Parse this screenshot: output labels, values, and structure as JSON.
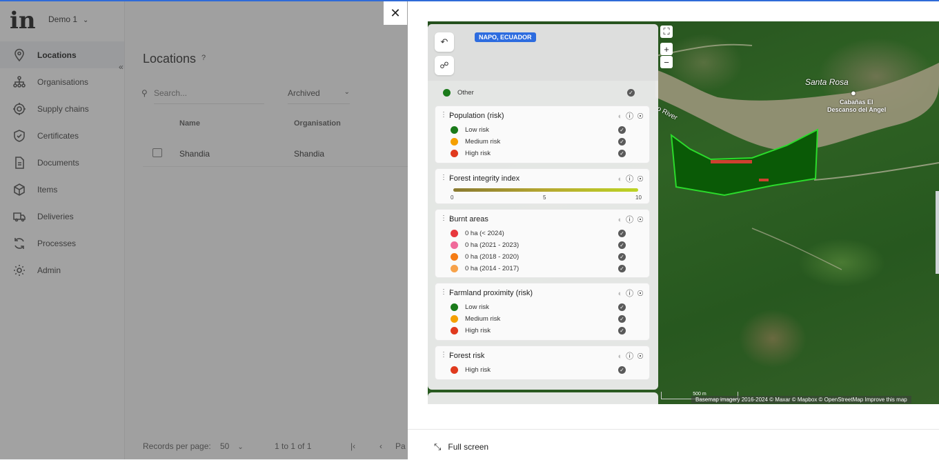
{
  "app": {
    "logo": "in",
    "org_selector": "Demo 1"
  },
  "sidebar": {
    "items": [
      {
        "label": "Locations",
        "icon": "location-pin-icon",
        "active": true
      },
      {
        "label": "Organisations",
        "icon": "org-chart-icon"
      },
      {
        "label": "Supply chains",
        "icon": "target-icon"
      },
      {
        "label": "Certificates",
        "icon": "shield-check-icon"
      },
      {
        "label": "Documents",
        "icon": "document-icon"
      },
      {
        "label": "Items",
        "icon": "cube-icon"
      },
      {
        "label": "Deliveries",
        "icon": "truck-icon"
      },
      {
        "label": "Processes",
        "icon": "refresh-icon"
      },
      {
        "label": "Admin",
        "icon": "gear-icon"
      }
    ]
  },
  "main": {
    "title": "Locations",
    "help": "?",
    "search_placeholder": "Search...",
    "filter": "Archived",
    "columns": [
      "Name",
      "Organisation"
    ],
    "rows": [
      {
        "name": "Shandia",
        "organisation": "Shandia"
      }
    ],
    "footer": {
      "records_label": "Records per page:",
      "records_value": "50",
      "range": "1 to 1 of 1",
      "page_prefix": "Pa"
    }
  },
  "modal": {
    "location_badge": "NAPO, ECUADOR",
    "partial_item": "Other",
    "layers": [
      {
        "title": "Population (risk)",
        "items": [
          {
            "label": "Low risk",
            "color": "#1a7a1a"
          },
          {
            "label": "Medium risk",
            "color": "#f5a000"
          },
          {
            "label": "High risk",
            "color": "#e03a1e"
          }
        ]
      },
      {
        "title": "Forest integrity index",
        "scale": [
          "0",
          "5",
          "10"
        ]
      },
      {
        "title": "Burnt areas",
        "items": [
          {
            "label": "0 ha (< 2024)",
            "color": "#e8383d"
          },
          {
            "label": "0 ha (2021 - 2023)",
            "color": "#f06a9a"
          },
          {
            "label": "0 ha (2018 - 2020)",
            "color": "#f57c14"
          },
          {
            "label": "0 ha (2014 - 2017)",
            "color": "#f7a24a"
          }
        ]
      },
      {
        "title": "Farmland proximity (risk)",
        "items": [
          {
            "label": "Low risk",
            "color": "#1a7a1a"
          },
          {
            "label": "Medium risk",
            "color": "#f5a000"
          },
          {
            "label": "High risk",
            "color": "#e03a1e"
          }
        ]
      },
      {
        "title": "Forest risk",
        "items": [
          {
            "label": "High risk",
            "color": "#e03a1e"
          }
        ]
      }
    ],
    "map_labels": {
      "town": "Santa Rosa",
      "poi_line1": "Cabañas El",
      "poi_line2": "Descanso del Angel",
      "river": "o River"
    },
    "scale_label": "500 m",
    "attribution": "Basemap imagery 2016-2024 © Maxar © Mapbox © OpenStreetMap Improve this map",
    "full_screen": "Full screen"
  }
}
